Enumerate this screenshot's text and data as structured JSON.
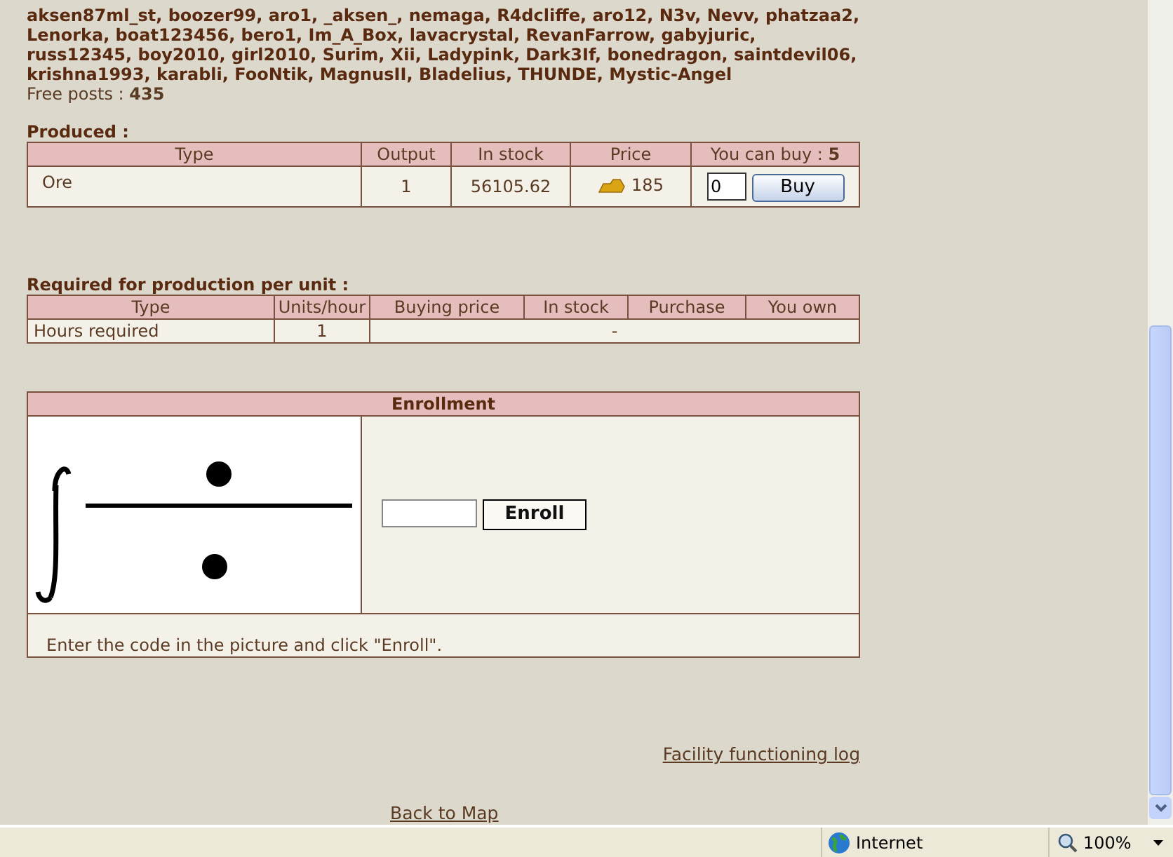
{
  "players_lines": [
    "aksen87ml_st, boozer99, aro1, _aksen_, nemaga, R4dcliffe, aro12, N3v, Nevv, phatzaa2,",
    "Lenorka, boat123456, bero1, Im_A_Box, lavacrystal, RevanFarrow, gabyjuric,",
    "russ12345, boy2010, girl2010, Surim, Xii, Ladypink, Dark3If, bonedragon, saintdevil06,",
    "krishna1993, karabli, FooNtik, MagnusII, Bladelius, THUNDE, Mystic-Angel"
  ],
  "free_posts": "Free posts : **435**",
  "produced": {
    "title": "Produced :",
    "columns": [
      "Type",
      "Output",
      "In stock",
      "Price",
      "You can buy : **5**"
    ],
    "rows": [
      {
        "type": "Ore",
        "output": "1",
        "in_stock": "56105.62",
        "price": "185",
        "quantity": "0",
        "button": "Buy"
      }
    ]
  },
  "required": {
    "title": "Required for production per unit :",
    "columns": [
      "Type",
      "Units/hour",
      "Buying price",
      "In stock",
      "Purchase",
      "You own"
    ],
    "rows": [
      {
        "type": "Hours required",
        "units_per_hour": "1",
        "rest": "-"
      }
    ]
  },
  "enrollment": {
    "title": "Enrollment",
    "button": "Enroll",
    "instructions": "Enter the code in the picture and click \"Enroll\"."
  },
  "facility_log_link": "Facility functioning log",
  "back_link": "Back to Map",
  "status_bar": {
    "zone": "Internet",
    "zoom": "100%"
  }
}
